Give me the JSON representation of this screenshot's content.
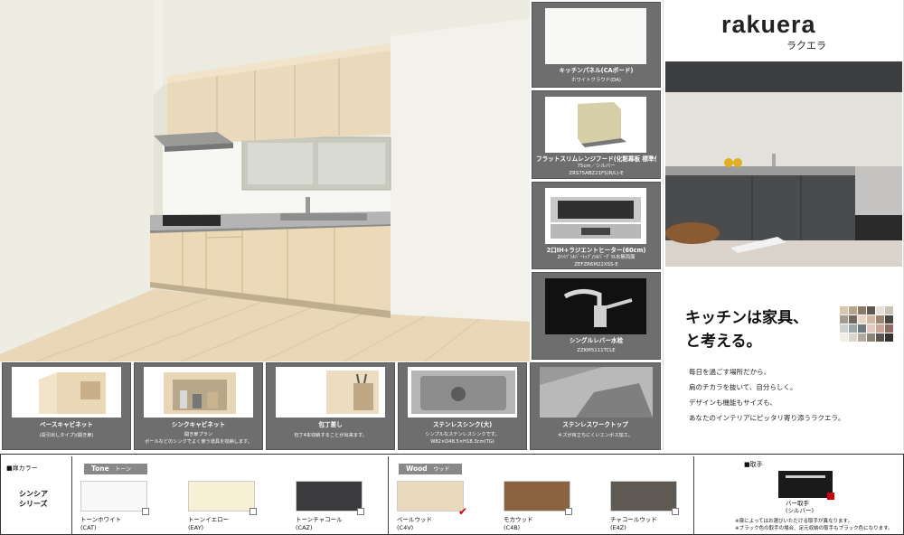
{
  "brand": {
    "logo": "rakuera",
    "logo_kana": "ラクエラ",
    "catch_line1": "キッチンは家具、",
    "catch_line2": "と考える。",
    "body_lines": [
      "毎日を過ごす場所だから、",
      "肩のチカラを抜いて、自分らしく。",
      "デザインも機能もサイズも、",
      "あなたのインテリアにピッタリ寄り添うラクエラ。"
    ]
  },
  "parts": [
    {
      "label": "キッチンパネル(CAボード)",
      "sub": [
        "ホワイトクラウド(DA)"
      ]
    },
    {
      "label": "フラットスリムレンジフード(化粧幕板 標準付)",
      "sub": [
        "75cm／シルバー",
        "ZRS75ABZ21FS(R/L)-E"
      ]
    },
    {
      "label": "2口IH+ラジエントヒーター(60cm)",
      "sub": [
        "2ﾊｲﾊﾟｼﾙﾊﾞｰﾄｯﾌﾟ/ｼﾙﾊﾞｰｸﾞﾘﾙ水無両面",
        "ZEFZR6M22XSS-E"
      ]
    },
    {
      "label": "シングルレバー水栓",
      "sub": [
        "ZZKM5111TCLE"
      ]
    }
  ],
  "features": [
    {
      "label": "ベースキャビネット",
      "sub": [
        "(段引出しタイプ)(開き扉)"
      ]
    },
    {
      "label": "シンクキャビネット",
      "sub": [
        "開き扉プラン",
        "ボールなどのシンクでよく使う道具を収納します。"
      ]
    },
    {
      "label": "包丁差し",
      "sub": [
        "包丁4本収納することが出来ます。"
      ]
    },
    {
      "label": "ステンレスシンク(大)",
      "sub": [
        "シンプルなステンレスシンクです。",
        "W82×D48.5×H18.3cm(TG)"
      ]
    },
    {
      "label": "ステンレスワークトップ",
      "sub": [
        "キズが目立ちにくいエンボス加工。"
      ]
    }
  ],
  "color_bar": {
    "door_color_heading": "■扉カラー",
    "series_line1": "シンシア",
    "series_line2": "シリーズ",
    "tone_tag": "Tone",
    "tone_tag_kana": "トーン",
    "wood_tag": "Wood",
    "wood_tag_kana": "ウッド",
    "handle_heading": "■取手",
    "swatches": [
      {
        "name": "トーンホワイト",
        "code": "(CAT)",
        "color": "#f8f8f8"
      },
      {
        "name": "トーンイエロー",
        "code": "(EAY)",
        "color": "#f6f0d4"
      },
      {
        "name": "トーンチャコール",
        "code": "(CAZ)",
        "color": "#3b3b3d"
      },
      {
        "name": "ペールウッド",
        "code": "(C4V)",
        "color": "#e9d9bd",
        "selected": true
      },
      {
        "name": "モカウッド",
        "code": "(C4B)",
        "color": "#8a6440"
      },
      {
        "name": "チャコールウッド",
        "code": "(E4Z)",
        "color": "#5e5953"
      }
    ],
    "handle": {
      "name": "バー取手",
      "sub": "(シルバー)",
      "color": "#1a1a1a"
    },
    "notes": [
      "※扉によってはお選びいただける取手が異なります。",
      "※ブラック色の取手の場合、足元収納の取手もブラック色になります。"
    ]
  }
}
